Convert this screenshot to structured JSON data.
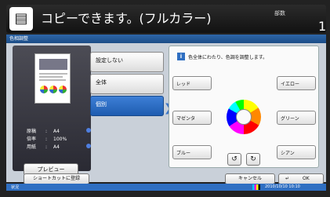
{
  "header": {
    "status_title": "コピーできます。(フルカラー)",
    "copies_label": "部数",
    "copies_value": "1"
  },
  "panel": {
    "title": "色相調整",
    "preview": {
      "rows": [
        {
          "key": "原稿",
          "value": "A4"
        },
        {
          "key": "倍率",
          "value": "100%"
        },
        {
          "key": "用紙",
          "value": "A4"
        }
      ],
      "preview_button": "プレビュー"
    },
    "modes": [
      {
        "label": "設定しない"
      },
      {
        "label": "全体"
      },
      {
        "label": "個別"
      }
    ],
    "instruction": "色全体にわたり、色調を調整します。",
    "colors": {
      "red": "レッド",
      "yellow": "イエロー",
      "magenta": "マゼンタ",
      "green": "グリーン",
      "blue": "ブルー",
      "cyan": "シアン"
    }
  },
  "bottom": {
    "shortcut_button": "ショートカットに登録",
    "cancel_button": "キャンセル",
    "ok_button": "OK"
  },
  "statusbar": {
    "status": "状況",
    "datetime": "2010/10/10 10:10"
  },
  "accent_color": "#2f6fc2",
  "icons": {
    "app": "document-copy-icon",
    "info": "info-icon",
    "rotate_left": "rotate-left-icon",
    "rotate_right": "rotate-right-icon",
    "enter": "enter-icon"
  }
}
